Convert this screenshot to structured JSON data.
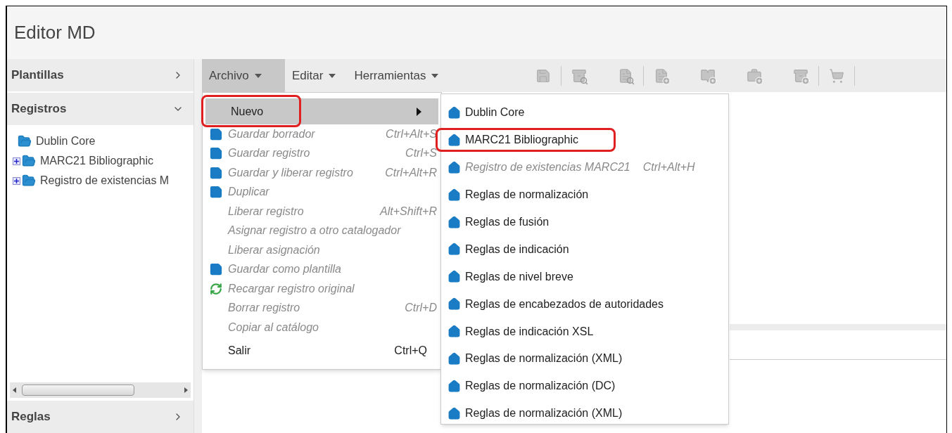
{
  "window": {
    "title": "Editor MD"
  },
  "sidebar": {
    "panels": [
      {
        "title": "Plantillas",
        "expanded": false
      },
      {
        "title": "Registros",
        "expanded": true,
        "tree": [
          {
            "label": "Dublin Core",
            "expandable": false
          },
          {
            "label": "MARC21 Bibliographic",
            "expandable": true
          },
          {
            "label": "Registro de existencias M",
            "expandable": true
          }
        ]
      },
      {
        "title": "Reglas",
        "expanded": false
      }
    ]
  },
  "menubar": [
    {
      "label": "Archivo",
      "selected": true
    },
    {
      "label": "Editar",
      "selected": false
    },
    {
      "label": "Herramientas",
      "selected": false
    }
  ],
  "file_menu": [
    {
      "label": "Nuevo",
      "kind": "plain",
      "disabled": false,
      "selected": true,
      "submenu": true,
      "annotated": true
    },
    {
      "label": "Guardar borrador",
      "shortcut": "Ctrl+Alt+S",
      "kind": "save",
      "disabled": true,
      "selected": false,
      "submenu": false,
      "annotated": false
    },
    {
      "label": "Guardar registro",
      "shortcut": "Ctrl+S",
      "kind": "save",
      "disabled": true,
      "selected": false,
      "submenu": false,
      "annotated": false
    },
    {
      "label": "Guardar y liberar registro",
      "shortcut": "Ctrl+Alt+R",
      "kind": "save",
      "disabled": true,
      "selected": false,
      "submenu": false,
      "annotated": false
    },
    {
      "label": "Duplicar",
      "kind": "save",
      "disabled": true,
      "selected": false,
      "submenu": false,
      "annotated": false
    },
    {
      "label": "Liberar registro",
      "shortcut": "Alt+Shift+R",
      "kind": "plain",
      "disabled": true,
      "selected": false,
      "submenu": false,
      "annotated": false
    },
    {
      "label": "Asignar registro a otro catalogador",
      "kind": "plain",
      "disabled": true,
      "selected": false,
      "submenu": false,
      "annotated": false
    },
    {
      "label": "Liberar asignación",
      "kind": "plain",
      "disabled": true,
      "selected": false,
      "submenu": false,
      "annotated": false
    },
    {
      "label": "Guardar como plantilla",
      "kind": "save",
      "disabled": true,
      "selected": false,
      "submenu": false,
      "annotated": false
    },
    {
      "label": "Recargar registro original",
      "kind": "reload",
      "disabled": true,
      "selected": false,
      "submenu": false,
      "annotated": false
    },
    {
      "label": "Borrar registro",
      "shortcut": "Ctrl+D",
      "kind": "plain",
      "disabled": true,
      "selected": false,
      "submenu": false,
      "annotated": false
    },
    {
      "label": "Copiar al catálogo",
      "kind": "plain",
      "disabled": true,
      "selected": false,
      "submenu": false,
      "annotated": false
    },
    {
      "label": "Salir",
      "shortcut": "Ctrl+Q",
      "kind": "plain",
      "disabled": false,
      "selected": false,
      "submenu": false,
      "annotated": false
    }
  ],
  "new_submenu": [
    {
      "label": "Dublin Core",
      "disabled": false,
      "annotated": false
    },
    {
      "label": "MARC21 Bibliographic",
      "disabled": false,
      "annotated": true
    },
    {
      "label": "Registro de existencias MARC21",
      "shortcut": "Ctrl+Alt+H",
      "disabled": true,
      "annotated": false
    },
    {
      "label": "Reglas de normalización",
      "disabled": false,
      "annotated": false
    },
    {
      "label": "Reglas de fusión",
      "disabled": false,
      "annotated": false
    },
    {
      "label": "Reglas de indicación",
      "disabled": false,
      "annotated": false
    },
    {
      "label": "Reglas de nivel breve",
      "disabled": false,
      "annotated": false
    },
    {
      "label": "Reglas de encabezados de autoridades",
      "disabled": false,
      "annotated": false
    },
    {
      "label": "Reglas de indicación XSL",
      "disabled": false,
      "annotated": false
    },
    {
      "label": "Reglas de normalización (XML)",
      "disabled": false,
      "annotated": false
    },
    {
      "label": "Reglas de normalización (DC)",
      "disabled": false,
      "annotated": false
    },
    {
      "label": "Reglas de normalización (XML)",
      "disabled": false,
      "annotated": false
    }
  ]
}
